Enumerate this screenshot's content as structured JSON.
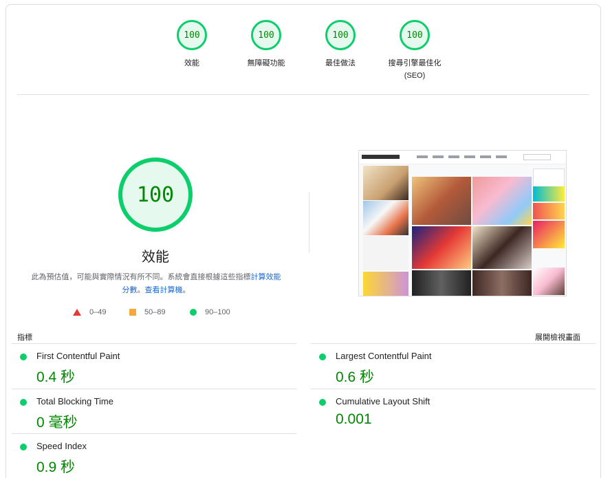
{
  "colors": {
    "pass": "#0cce6b",
    "pass_text": "#008800",
    "average": "#f4a93a",
    "fail": "#e53935",
    "link": "#1967d2"
  },
  "categories": [
    {
      "score": "100",
      "label": "效能"
    },
    {
      "score": "100",
      "label": "無障礙功能"
    },
    {
      "score": "100",
      "label": "最佳做法"
    },
    {
      "score": "100",
      "label": "搜尋引擎最佳化",
      "sublabel": "(SEO)"
    }
  ],
  "performance": {
    "score": "100",
    "title": "效能",
    "note_text": "此為預估值，可能與實際情況有所不同。系統會直接根據這些指標",
    "note_link1": "計算效能分數",
    "note_sep": "。",
    "note_link2": "查看計算機",
    "note_end": "。"
  },
  "legend": {
    "fail": "0–49",
    "average": "50–89",
    "pass": "90–100"
  },
  "metrics": {
    "header": "指標",
    "expand_label": "展開檢視畫面",
    "items": [
      {
        "name": "First Contentful Paint",
        "value": "0.4 秒",
        "icon": "green-circle"
      },
      {
        "name": "Largest Contentful Paint",
        "value": "0.6 秒",
        "icon": "green-circle"
      },
      {
        "name": "Total Blocking Time",
        "value": "0 毫秒",
        "icon": "green-circle"
      },
      {
        "name": "Cumulative Layout Shift",
        "value": "0.001",
        "icon": "green-circle"
      },
      {
        "name": "Speed Index",
        "value": "0.9 秒",
        "icon": "green-circle"
      }
    ]
  }
}
